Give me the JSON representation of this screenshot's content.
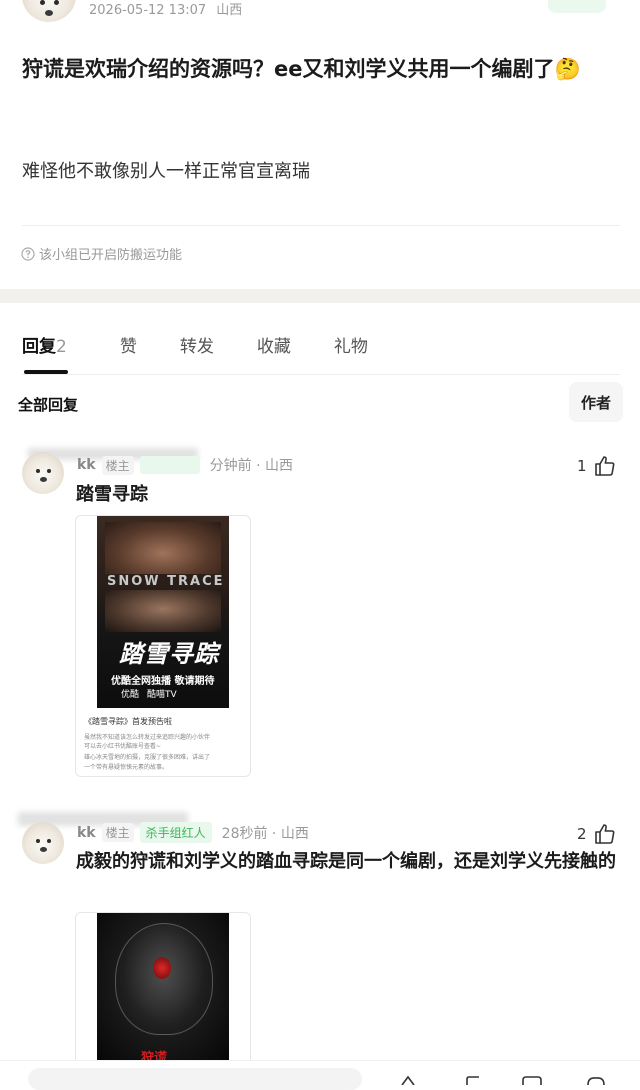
{
  "post": {
    "timestamp": "2026-05-12 13:07",
    "location": "山西",
    "title": "狩谎是欢瑞介绍的资源吗？ee又和刘学义共用一个编剧了🤔",
    "body": "难怪他不敢像别人一样正常官宣离瑞",
    "notice": "该小组已开启防搬运功能"
  },
  "tabs": [
    {
      "label": "回复",
      "count": "2"
    },
    {
      "label": "赞"
    },
    {
      "label": "转发"
    },
    {
      "label": "收藏"
    },
    {
      "label": "礼物"
    }
  ],
  "filter": {
    "all_replies": "全部回复",
    "author_only": "作者"
  },
  "replies": [
    {
      "nickname": "kk",
      "owner_tag": "楼主",
      "green_tag": "",
      "time": "分钟前",
      "location": "山西",
      "likes": "1",
      "text": "踏雪寻踪",
      "image": {
        "poster_en": "SNOW TRACE",
        "poster_cn": "踏雪寻踪",
        "poster_slogan": "优酷全网独播 敬请期待",
        "brand_a": "优酷",
        "brand_b": "酷喵TV",
        "caption_title": "《踏雪寻踪》首发预告啦",
        "caption_lines": [
          "虽然我不知道该怎么转发过来追踪兴趣的小伙伴",
          "可以去小红书优酷账号查看~",
          "雄心冰天雪地的拍摄，克服了很多困难，讲出了",
          "一个带有悬疑惊悚元素的故事。"
        ]
      }
    },
    {
      "nickname": "kk",
      "owner_tag": "楼主",
      "green_tag": "杀手组红人",
      "time": "28秒前",
      "location": "山西",
      "likes": "2",
      "text": "成毅的狩谎和刘学义的踏血寻踪是同一个编剧，还是刘学义先接触的",
      "image": {
        "poster_cn": "狩谎"
      }
    }
  ],
  "colors": {
    "accent_green": "#3fb55c",
    "tag_green_bg": "#e9f8ec",
    "muted_text": "#999999"
  }
}
